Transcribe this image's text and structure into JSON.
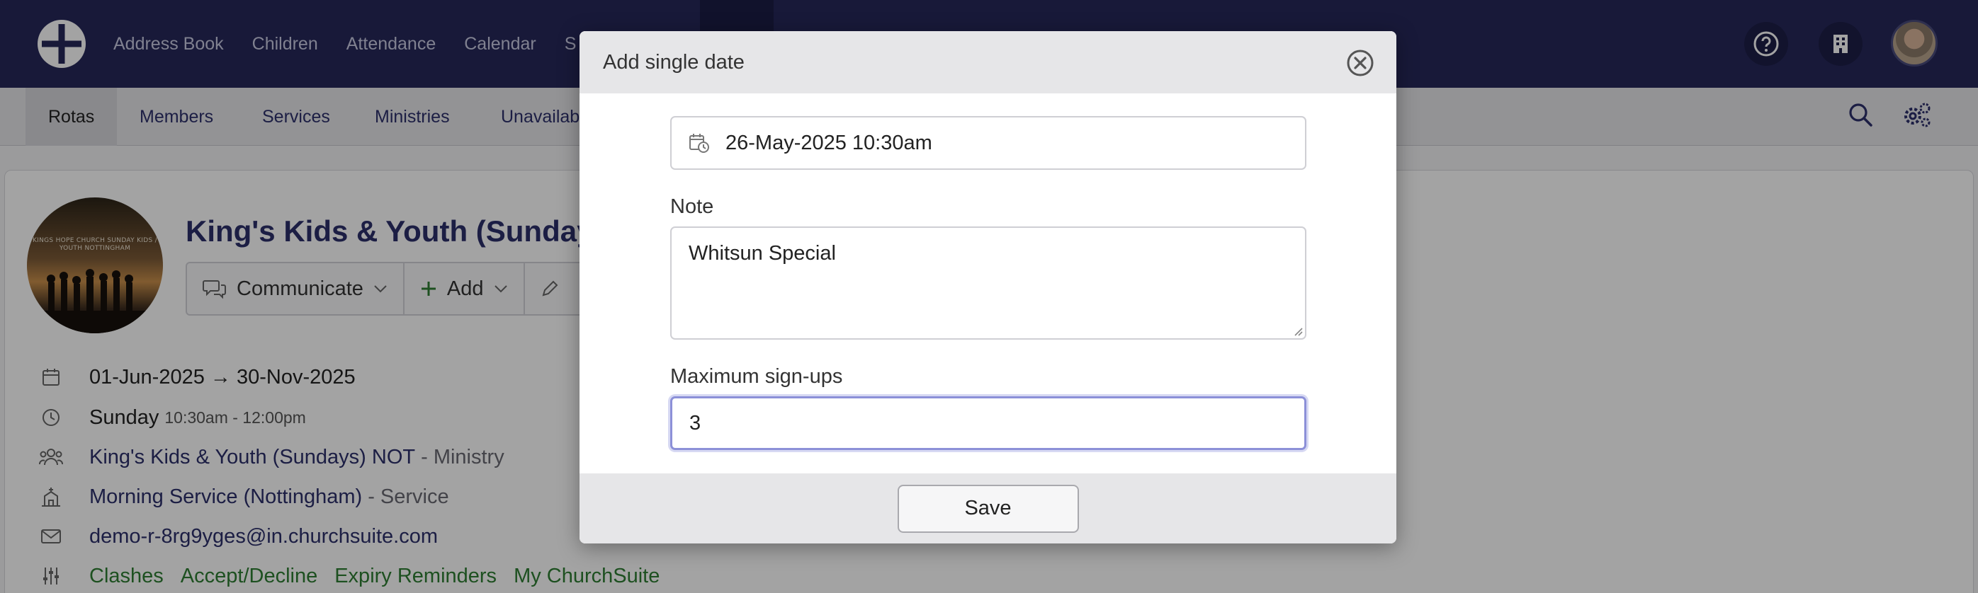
{
  "colors": {
    "topbar_bg": "#26285a",
    "link": "#2c2f6b",
    "green_link": "#2e7d32",
    "focus_ring": "#8c90d8"
  },
  "topnav": {
    "logo_icon": "church-cross-logo-icon",
    "items": [
      {
        "label": "Address Book"
      },
      {
        "label": "Children"
      },
      {
        "label": "Attendance"
      },
      {
        "label": "Calendar"
      },
      {
        "label": "S"
      }
    ],
    "help_icon": "help-circle-icon",
    "building_icon": "building-icon"
  },
  "subnav": {
    "tabs": [
      {
        "label": "Rotas",
        "active": true
      },
      {
        "label": "Members"
      },
      {
        "label": "Services"
      },
      {
        "label": "Ministries"
      },
      {
        "label": "Unavailab"
      }
    ],
    "search_icon": "search-icon",
    "settings_icon": "gears-icon"
  },
  "group": {
    "image_text": "KINGS HOPE CHURCH SUNDAY KIDS / YOUTH NOTTINGHAM",
    "title": "King's Kids & Youth (Sundays",
    "actions": {
      "communicate": "Communicate",
      "add": "Add"
    },
    "date_range": "01-Jun-2025 → 30-Nov-2025",
    "day": "Sunday",
    "time": "10:30am - 12:00pm",
    "ministry_link": "King's Kids & Youth (Sundays) NOT",
    "ministry_suffix": "- Ministry",
    "service_link": "Morning Service (Nottingham)",
    "service_suffix": "- Service",
    "email": "demo-r-8rg9yges@in.churchsuite.com",
    "settings_links": [
      "Clashes",
      "Accept/Decline",
      "Expiry Reminders",
      "My ChurchSuite"
    ]
  },
  "modal": {
    "title": "Add single date",
    "date_value": "26-May-2025 10:30am",
    "note_label": "Note",
    "note_value": "Whitsun Special",
    "max_label": "Maximum sign-ups",
    "max_value": "3",
    "save_label": "Save"
  }
}
